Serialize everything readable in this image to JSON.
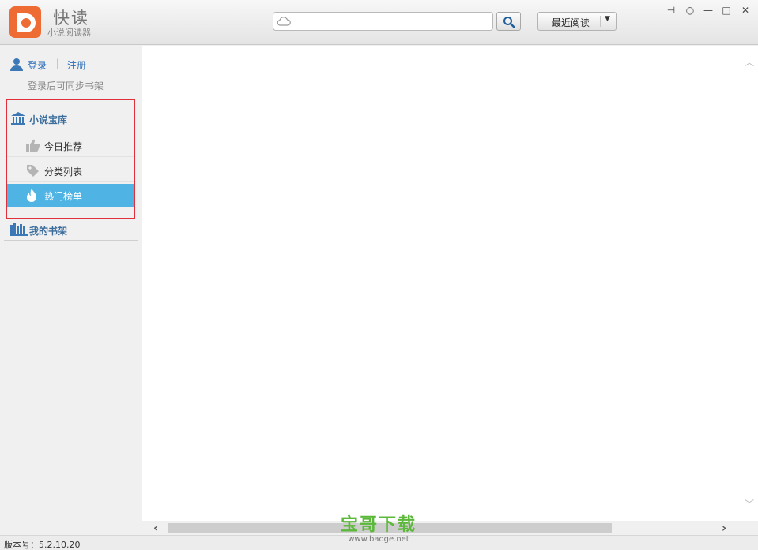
{
  "app": {
    "title": "快读",
    "subtitle": "小说阅读器",
    "brand_color": "#ef6b34"
  },
  "search": {
    "value": "",
    "placeholder": ""
  },
  "recent_button": {
    "label": "最近阅读"
  },
  "window_controls": {
    "pin": "⊣",
    "feedback": "○",
    "minimize": "—",
    "maximize": "□",
    "close": "✕"
  },
  "user": {
    "login": "登录",
    "separator": "|",
    "register": "注册",
    "sync_hint": "登录后可同步书架"
  },
  "sidebar": {
    "library_title": "小说宝库",
    "items": [
      {
        "label": "今日推荐",
        "icon": "thumbs-up-icon",
        "active": false
      },
      {
        "label": "分类列表",
        "icon": "tag-icon",
        "active": false
      },
      {
        "label": "热门榜单",
        "icon": "flame-icon",
        "active": true
      }
    ],
    "bookshelf_title": "我的书架",
    "active_color": "#4fb3e3",
    "highlight_color": "#e0303a"
  },
  "status": {
    "version": "版本号：5.2.10.20"
  },
  "watermark": {
    "title": "宝哥下载",
    "url": "www.baoge.net"
  }
}
